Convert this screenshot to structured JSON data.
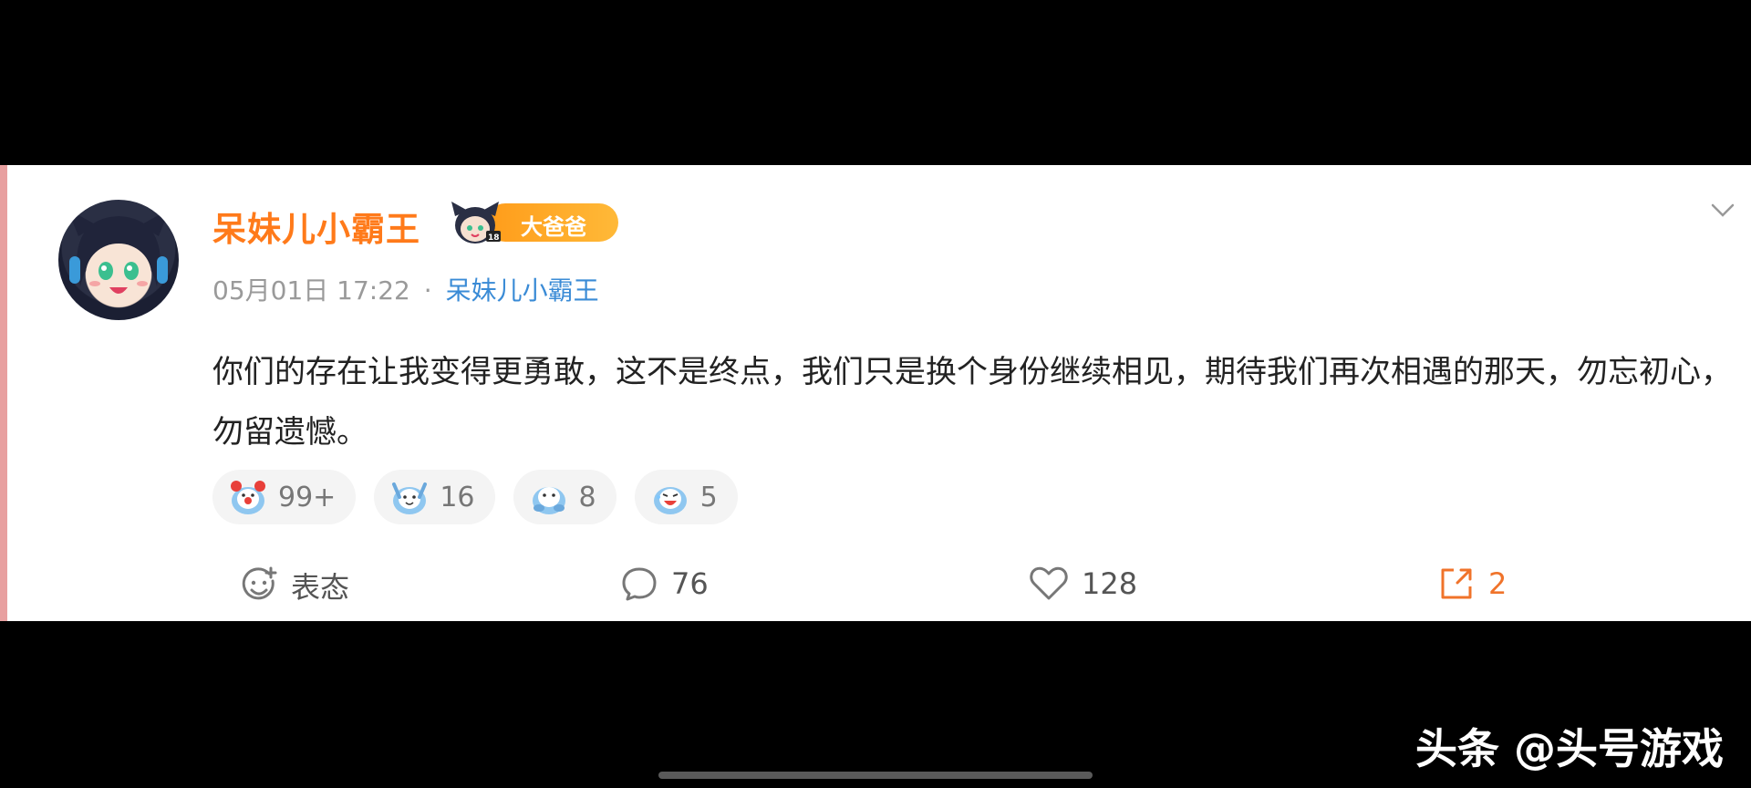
{
  "post": {
    "username": "呆妹儿小霸王",
    "badge": "大爸爸",
    "date": "05月01日 17:22",
    "separator": "·",
    "source": "呆妹儿小霸王",
    "content": "你们的存在让我变得更勇敢，这不是终点，我们只是换个身份继续相见，期待我们再次相遇的那天，勿忘初心，勿留遗憾。"
  },
  "reactions": [
    {
      "icon": "clown-emoji-icon",
      "count": "99+"
    },
    {
      "icon": "cheer-emoji-icon",
      "count": "16"
    },
    {
      "icon": "hug-emoji-icon",
      "count": "8"
    },
    {
      "icon": "laugh-emoji-icon",
      "count": "5"
    }
  ],
  "actions": {
    "react_label": "表态",
    "comments": "76",
    "likes": "128",
    "shares": "2"
  },
  "watermark": "头条 @头号游戏",
  "colors": {
    "username": "#ff7a1a",
    "badge": "#ffa62a",
    "source_link": "#3a8bd6",
    "share": "#f0732a",
    "card_border": "#e8a0a0"
  }
}
